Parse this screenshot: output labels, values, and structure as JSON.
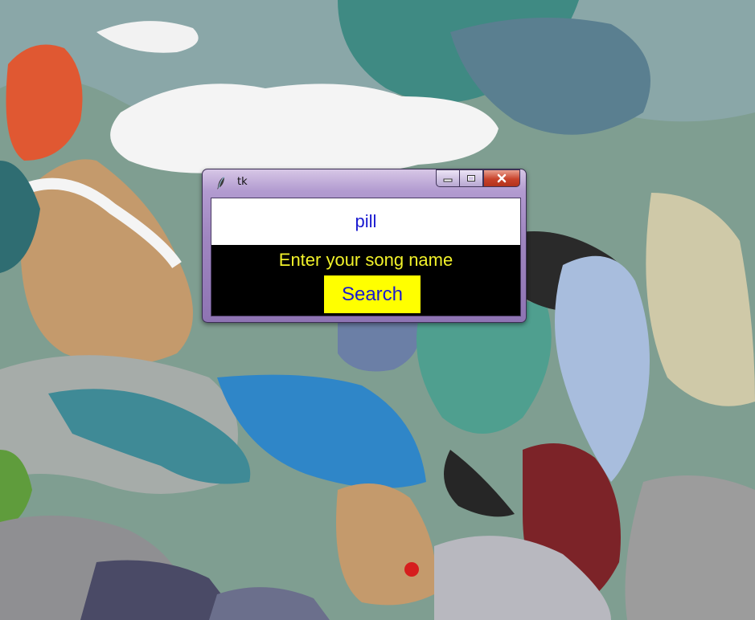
{
  "window": {
    "title": "tk",
    "icon": "feather-icon",
    "controls": [
      "minimize-icon",
      "maximize-icon",
      "close-icon"
    ]
  },
  "form": {
    "song_input_value": "pill",
    "prompt_label": "Enter your song name",
    "search_label": "Search"
  },
  "colors": {
    "input_text": "#1a1ad0",
    "label_text": "#f2f22a",
    "button_bg": "#ffff00",
    "client_bg": "#000000"
  }
}
